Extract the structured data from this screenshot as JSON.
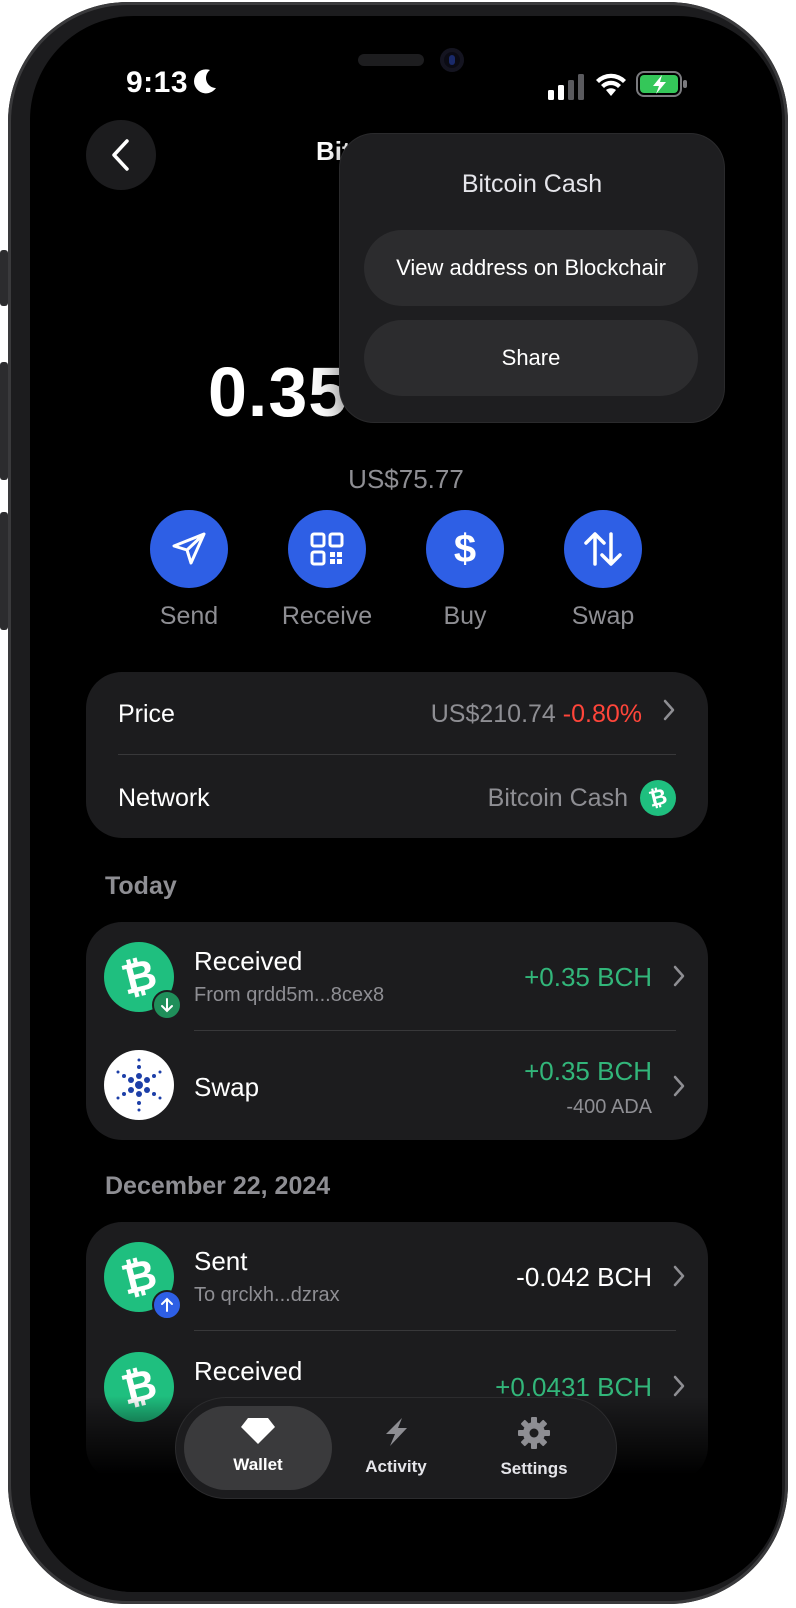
{
  "status_bar": {
    "time": "9:13"
  },
  "header": {
    "title": "Bit"
  },
  "balance": {
    "amount": "0.35",
    "fiat": "US$75.77"
  },
  "actions": [
    {
      "label": "Send",
      "icon": "send-icon"
    },
    {
      "label": "Receive",
      "icon": "qr-code-icon"
    },
    {
      "label": "Buy",
      "icon": "dollar-icon"
    },
    {
      "label": "Swap",
      "icon": "swap-arrows-icon"
    }
  ],
  "info": {
    "price_label": "Price",
    "price_value": "US$210.74",
    "price_change": "-0.80%",
    "network_label": "Network",
    "network_value": "Bitcoin Cash"
  },
  "sections": [
    {
      "header": "Today",
      "transactions": [
        {
          "title": "Received",
          "subtitle": "From qrdd5m...8cex8",
          "amount": "+0.35 BCH"
        },
        {
          "title": "Swap",
          "amount": "+0.35 BCH",
          "secondary": "-400 ADA"
        }
      ]
    },
    {
      "header": "December 22, 2024",
      "transactions": [
        {
          "title": "Sent",
          "subtitle": "To qrclxh...dzrax",
          "amount": "-0.042 BCH"
        },
        {
          "title": "Received",
          "amount": "+0.0431 BCH"
        }
      ]
    }
  ],
  "menu": {
    "title": "Bitcoin Cash",
    "items": [
      "View address on Blockchair",
      "Share"
    ]
  },
  "tabs": [
    {
      "label": "Wallet",
      "icon": "diamond-icon"
    },
    {
      "label": "Activity",
      "icon": "lightning-icon"
    },
    {
      "label": "Settings",
      "icon": "gear-icon"
    }
  ],
  "colors": {
    "accent": "#2e5fe5",
    "positive": "#32b67a",
    "negative": "#ff453a",
    "bch": "#1fbf7f"
  }
}
